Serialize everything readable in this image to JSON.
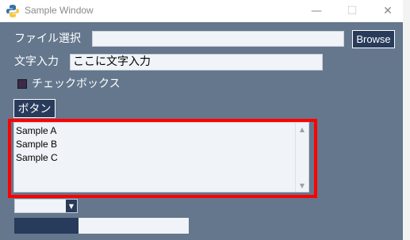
{
  "window": {
    "title": "Sample Window"
  },
  "controls": {
    "minimize": "—",
    "maximize": "☐",
    "close": "✕"
  },
  "file_row": {
    "label": "ファイル選択",
    "value": "",
    "browse_label": "Browse"
  },
  "text_row": {
    "label": "文字入力",
    "value": "ここに文字入力"
  },
  "checkbox": {
    "label": "チェックボックス",
    "checked": false
  },
  "button": {
    "label": "ボタン"
  },
  "listbox": {
    "items": [
      "Sample A",
      "Sample B",
      "Sample C"
    ],
    "up_arrow": "▲",
    "down_arrow": "▼"
  },
  "combo": {
    "value": "",
    "arrow": "▼"
  },
  "progress": {
    "fraction": 0.37
  },
  "colors": {
    "window_bg": "#64778d",
    "button_bg": "#283b5b",
    "highlight": "#ff0000"
  }
}
